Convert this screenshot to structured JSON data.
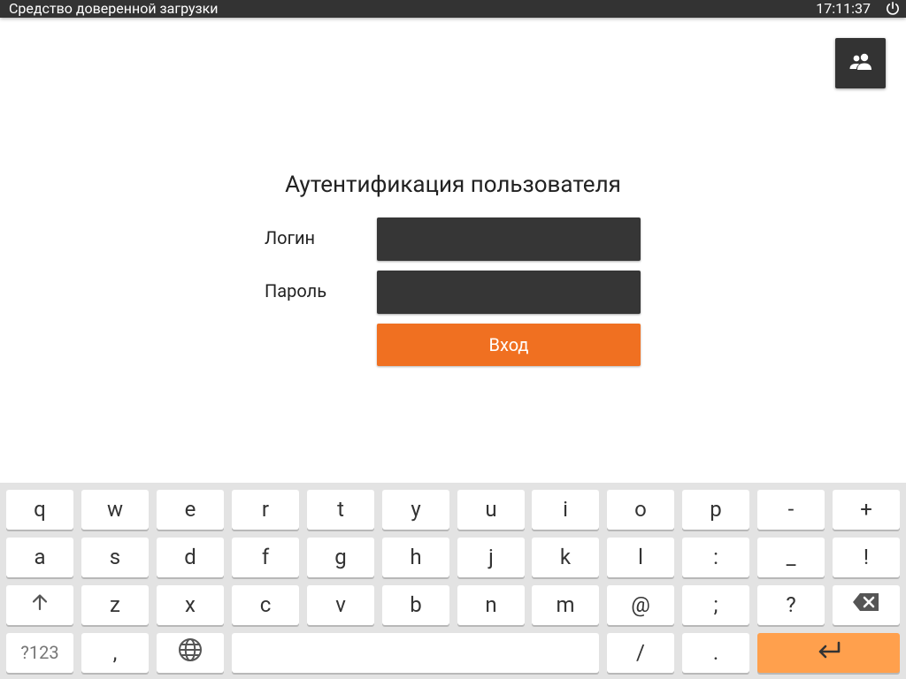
{
  "topbar": {
    "title": "Средство доверенной загрузки",
    "time": "17:11:37"
  },
  "auth": {
    "title": "Аутентификация пользователя",
    "login_label": "Логин",
    "login_value": "",
    "password_label": "Пароль",
    "password_value": "",
    "submit_label": "Вход"
  },
  "keyboard": {
    "row1": [
      "q",
      "w",
      "e",
      "r",
      "t",
      "y",
      "u",
      "i",
      "o",
      "p",
      "-",
      "+"
    ],
    "row2": [
      "a",
      "s",
      "d",
      "f",
      "g",
      "h",
      "j",
      "k",
      "l",
      ":",
      "_",
      "!"
    ],
    "row3": [
      "z",
      "x",
      "c",
      "v",
      "b",
      "n",
      "m",
      "@",
      ";",
      "?"
    ],
    "numbers_label": "?123",
    "comma": ",",
    "slash": "/",
    "period": "."
  },
  "colors": {
    "topbar": "#333333",
    "input_bg": "#363636",
    "accent": "#f07021",
    "enter_key": "#ffa04d",
    "keyboard_bg": "#e3e3e3"
  },
  "icons": {
    "power": "power-icon",
    "users": "users-icon",
    "shift": "shift-arrow-icon",
    "backspace": "backspace-icon",
    "language": "globe-icon",
    "enter": "enter-icon"
  }
}
